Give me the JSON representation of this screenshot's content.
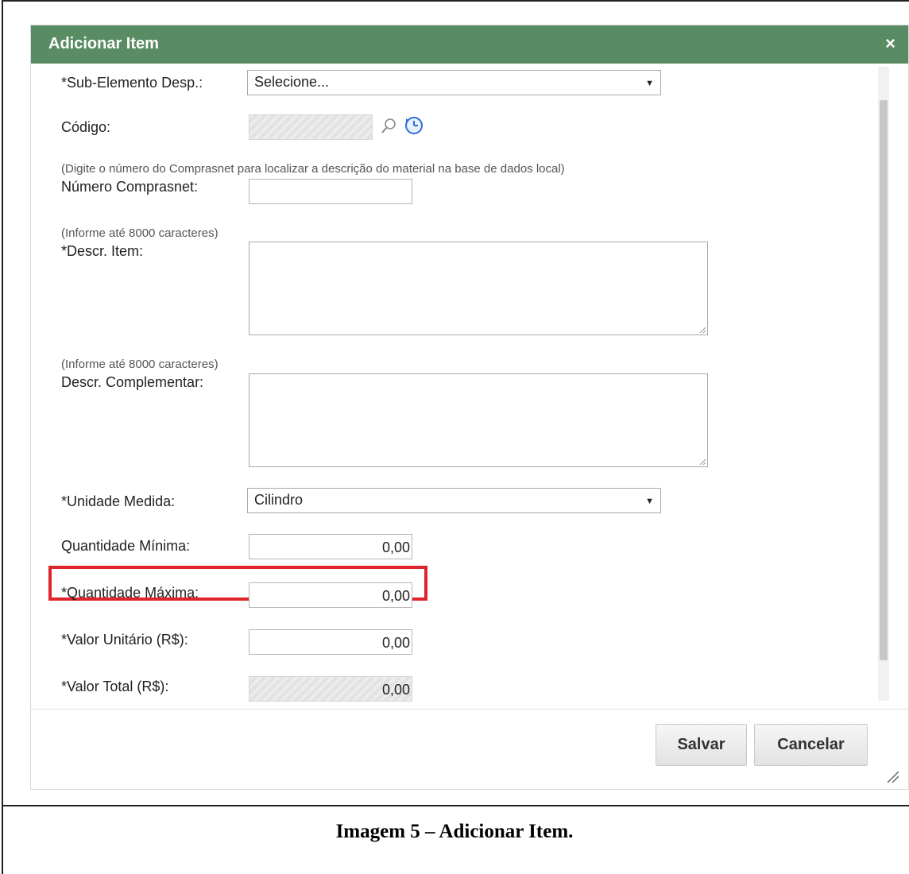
{
  "dialog": {
    "title": "Adicionar Item",
    "close_glyph": "×"
  },
  "fields": {
    "sub_elemento": {
      "label": "*Sub-Elemento Desp.:",
      "value": "Selecione..."
    },
    "codigo": {
      "label": "Código:",
      "value": ""
    },
    "comprasnet_hint": "(Digite o número do Comprasnet para localizar a descrição do material na base de dados local)",
    "numero_comprasnet": {
      "label": "Número Comprasnet:",
      "value": ""
    },
    "descr_item_hint": "(Informe até 8000 caracteres)",
    "descr_item": {
      "label": "*Descr. Item:",
      "value": ""
    },
    "descr_compl_hint": "(Informe até 8000 caracteres)",
    "descr_complementar": {
      "label": "Descr. Complementar:",
      "value": ""
    },
    "unidade_medida": {
      "label": "*Unidade Medida:",
      "value": "Cilindro"
    },
    "quantidade_minima": {
      "label": "Quantidade Mínima:",
      "value": "0,00"
    },
    "quantidade_maxima": {
      "label": "*Quantidade Máxima:",
      "value": "0,00"
    },
    "valor_unitario": {
      "label": "*Valor Unitário (R$):",
      "value": "0,00"
    },
    "valor_total": {
      "label": "*Valor Total (R$):",
      "value": "0,00"
    }
  },
  "icons": {
    "search": "search-icon",
    "history": "clock-icon"
  },
  "buttons": {
    "save": "Salvar",
    "cancel": "Cancelar"
  },
  "caption": "Imagem 5 – Adicionar Item.",
  "colors": {
    "titlebar": "#5a8c63",
    "highlight": "#e0242b"
  }
}
